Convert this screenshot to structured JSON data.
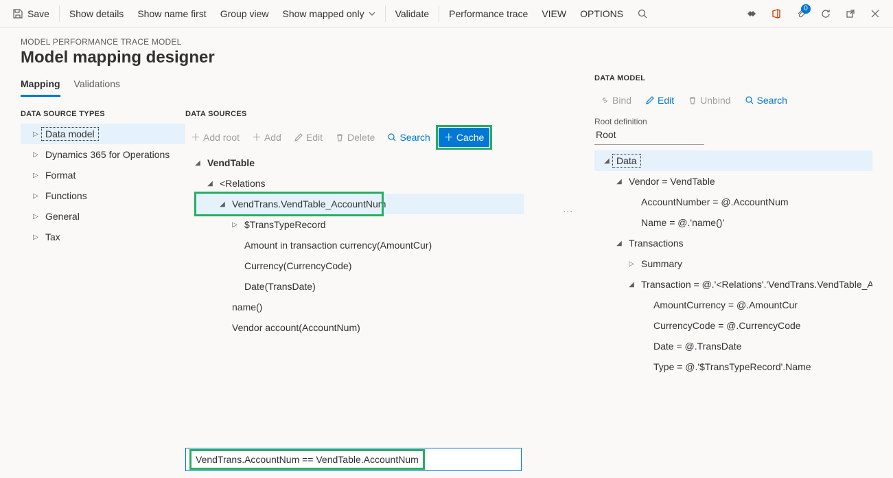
{
  "toolbar": {
    "save": "Save",
    "show_details": "Show details",
    "show_name_first": "Show name first",
    "group_view": "Group view",
    "show_mapped_only": "Show mapped only",
    "validate": "Validate",
    "performance_trace": "Performance trace",
    "view": "VIEW",
    "options": "OPTIONS",
    "badge_count": "0"
  },
  "breadcrumb": "MODEL PERFORMANCE TRACE MODEL",
  "page_title": "Model mapping designer",
  "tabs": {
    "mapping": "Mapping",
    "validations": "Validations"
  },
  "sections": {
    "data_source_types": "DATA SOURCE TYPES",
    "data_sources": "DATA SOURCES",
    "data_model": "DATA MODEL"
  },
  "data_source_types": [
    "Data model",
    "Dynamics 365 for Operations",
    "Format",
    "Functions",
    "General",
    "Tax"
  ],
  "ds_toolbar": {
    "add_root": "Add root",
    "add": "Add",
    "edit": "Edit",
    "delete": "Delete",
    "search": "Search",
    "cache": "Cache"
  },
  "ds_tree": {
    "n0": "VendTable",
    "n1": "<Relations",
    "n2": "VendTrans.VendTable_AccountNum",
    "n3": "$TransTypeRecord",
    "n4": "Amount in transaction currency(AmountCur)",
    "n5": "Currency(CurrencyCode)",
    "n6": "Date(TransDate)",
    "n7": "name()",
    "n8": "Vendor account(AccountNum)"
  },
  "formula": "VendTrans.AccountNum == VendTable.AccountNum",
  "dm_toolbar": {
    "bind": "Bind",
    "edit": "Edit",
    "unbind": "Unbind",
    "search": "Search"
  },
  "dm_root_label": "Root definition",
  "dm_root_value": "Root",
  "dm_tree": {
    "n0": "Data",
    "n1": "Vendor = VendTable",
    "n2": "AccountNumber = @.AccountNum",
    "n3": "Name = @.'name()'",
    "n4": "Transactions",
    "n5": "Summary",
    "n6": "Transaction = @.'<Relations'.'VendTrans.VendTable_AccountNum'",
    "n7": "AmountCurrency = @.AmountCur",
    "n8": "CurrencyCode = @.CurrencyCode",
    "n9": "Date = @.TransDate",
    "n10": "Type = @.'$TransTypeRecord'.Name"
  }
}
